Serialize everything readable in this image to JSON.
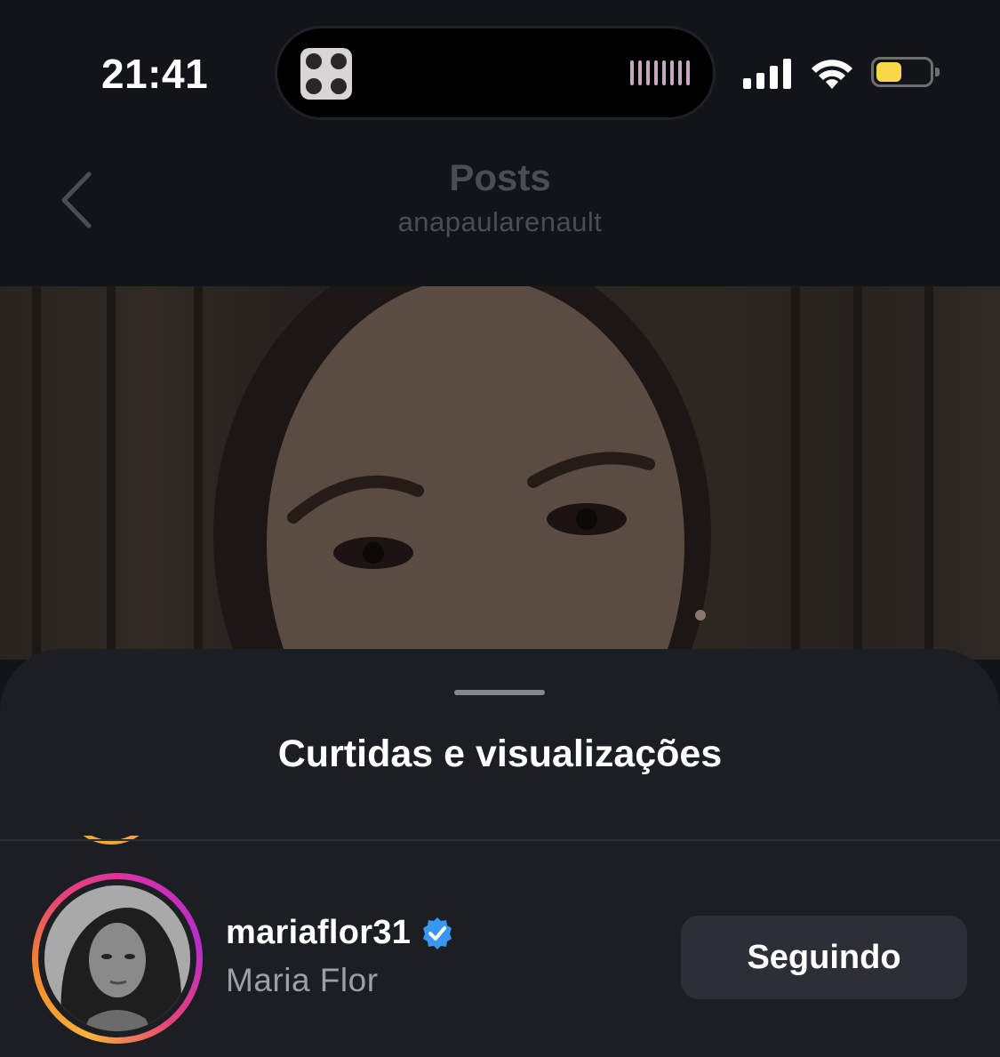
{
  "status_bar": {
    "time": "21:41",
    "battery_level": 0.4,
    "battery_color": "#f6d84a"
  },
  "header": {
    "title": "Posts",
    "subtitle": "anapaularenault",
    "back_icon": "chevron-left-icon"
  },
  "sheet": {
    "title": "Curtidas e visualizações"
  },
  "likers": [
    {
      "username": "mariaflor31",
      "full_name": "Maria Flor",
      "verified": true,
      "follow_label": "Seguindo"
    }
  ],
  "colors": {
    "background": "#111418",
    "sheet": "#1b1e22",
    "button": "#2c3036",
    "verified": "#3897f0"
  }
}
